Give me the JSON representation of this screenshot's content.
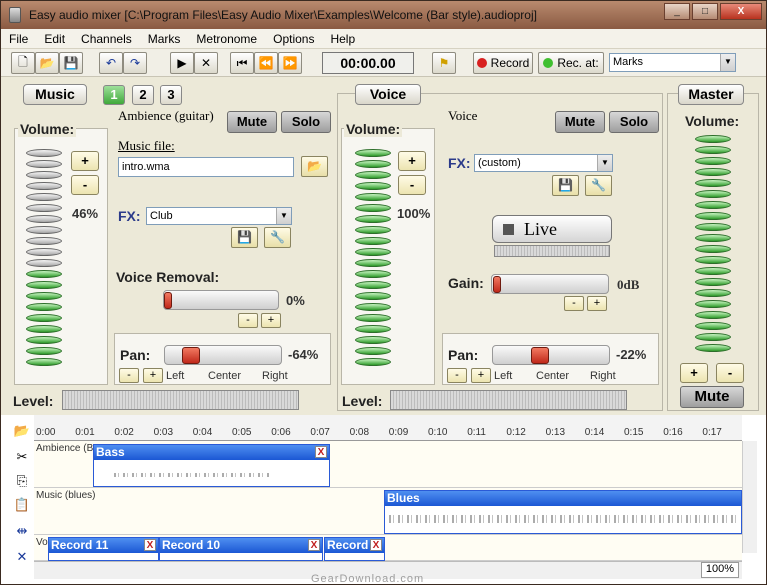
{
  "window": {
    "title": "Easy audio mixer [C:\\Program Files\\Easy Audio Mixer\\Examples\\Welcome (Bar style).audioproj]",
    "buttons": [
      "_",
      "□",
      "X"
    ]
  },
  "menu": [
    "File",
    "Edit",
    "Channels",
    "Marks",
    "Metronome",
    "Options",
    "Help"
  ],
  "toolbar": {
    "time": "00:00.00",
    "record_label": "Record",
    "rec_at_label": "Rec. at:",
    "marks_value": "Marks"
  },
  "music": {
    "title": "Music",
    "tabs": [
      "1",
      "2",
      "3"
    ],
    "volume_label": "Volume:",
    "volume_percent": "46%",
    "volume_level": 0.46,
    "channel_name": "Ambience (guitar)",
    "mute_label": "Mute",
    "solo_label": "Solo",
    "music_file_label": "Music file:",
    "music_file_value": "intro.wma",
    "fx_label": "FX:",
    "fx_value": "Club",
    "voice_removal_label": "Voice Removal:",
    "voice_removal_value": "0%",
    "pan_label": "Pan:",
    "pan_value": "-64%",
    "pan_left": "Left",
    "pan_center": "Center",
    "pan_right": "Right",
    "level_label": "Level:",
    "plus": "+",
    "minus": "-"
  },
  "voice": {
    "title": "Voice",
    "volume_label": "Volume:",
    "volume_percent": "100%",
    "volume_level": 1.0,
    "channel_name": "Voice",
    "mute_label": "Mute",
    "solo_label": "Solo",
    "fx_label": "FX:",
    "fx_value": "(custom)",
    "live_label": "Live",
    "gain_label": "Gain:",
    "gain_value": "0dB",
    "pan_label": "Pan:",
    "pan_value": "-22%",
    "pan_left": "Left",
    "pan_center": "Center",
    "pan_right": "Right",
    "level_label": "Level:"
  },
  "master": {
    "title": "Master",
    "volume_label": "Volume:",
    "mute_label": "Mute"
  },
  "timeline": {
    "ticks": [
      "0:00",
      "0:01",
      "0:02",
      "0:03",
      "0:04",
      "0:05",
      "0:06",
      "0:07",
      "0:08",
      "0:09",
      "0:10",
      "0:11",
      "0:12",
      "0:13",
      "0:14",
      "0:15",
      "0:16",
      "0:17"
    ],
    "tracks": [
      {
        "name": "Ambience (B",
        "clips": [
          {
            "label": "Bass"
          }
        ]
      },
      {
        "name": "Music (blues)",
        "clips": [
          {
            "label": "Blues"
          }
        ]
      },
      {
        "name": "Vo",
        "clips": [
          {
            "label": "Record 11"
          },
          {
            "label": "Record 10"
          },
          {
            "label": "Record"
          }
        ]
      }
    ],
    "zoom": "100%",
    "close_mark": "X"
  },
  "watermark": "GearDownload.com"
}
